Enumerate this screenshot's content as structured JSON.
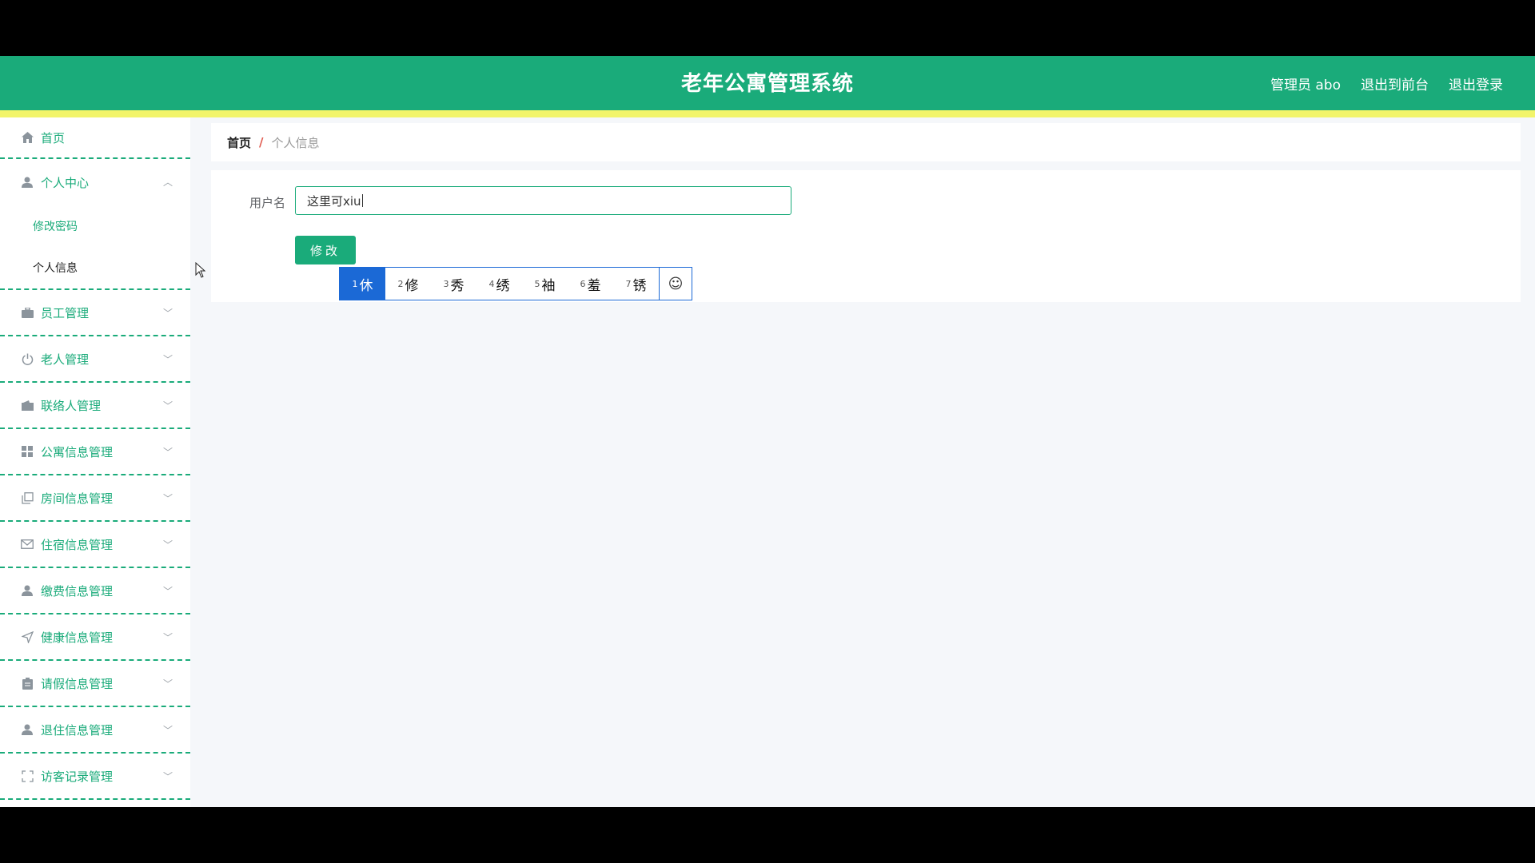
{
  "header": {
    "title": "老年公寓管理系统",
    "admin_label": "管理员 abo",
    "front_label": "退出到前台",
    "logout_label": "退出登录"
  },
  "sidebar": {
    "home": "首页",
    "personal_center": "个人中心",
    "change_password": "修改密码",
    "personal_info": "个人信息",
    "items": [
      "员工管理",
      "老人管理",
      "联络人管理",
      "公寓信息管理",
      "房间信息管理",
      "住宿信息管理",
      "缴费信息管理",
      "健康信息管理",
      "请假信息管理",
      "退住信息管理",
      "访客记录管理"
    ]
  },
  "breadcrumb": {
    "home": "首页",
    "separator": "/",
    "current": "个人信息"
  },
  "form": {
    "username_label": "用户名",
    "username_value": "这里可xiu",
    "submit_label": "修改"
  },
  "ime": {
    "candidates": [
      {
        "num": "1",
        "char": "休"
      },
      {
        "num": "2",
        "char": "修"
      },
      {
        "num": "3",
        "char": "秀"
      },
      {
        "num": "4",
        "char": "绣"
      },
      {
        "num": "5",
        "char": "袖"
      },
      {
        "num": "6",
        "char": "羞"
      },
      {
        "num": "7",
        "char": "锈"
      }
    ],
    "emoji_icon": "☺"
  },
  "colors": {
    "brand": "#1aab7a",
    "accent_strip": "#f2f46a",
    "ime_blue": "#1b69d6"
  }
}
